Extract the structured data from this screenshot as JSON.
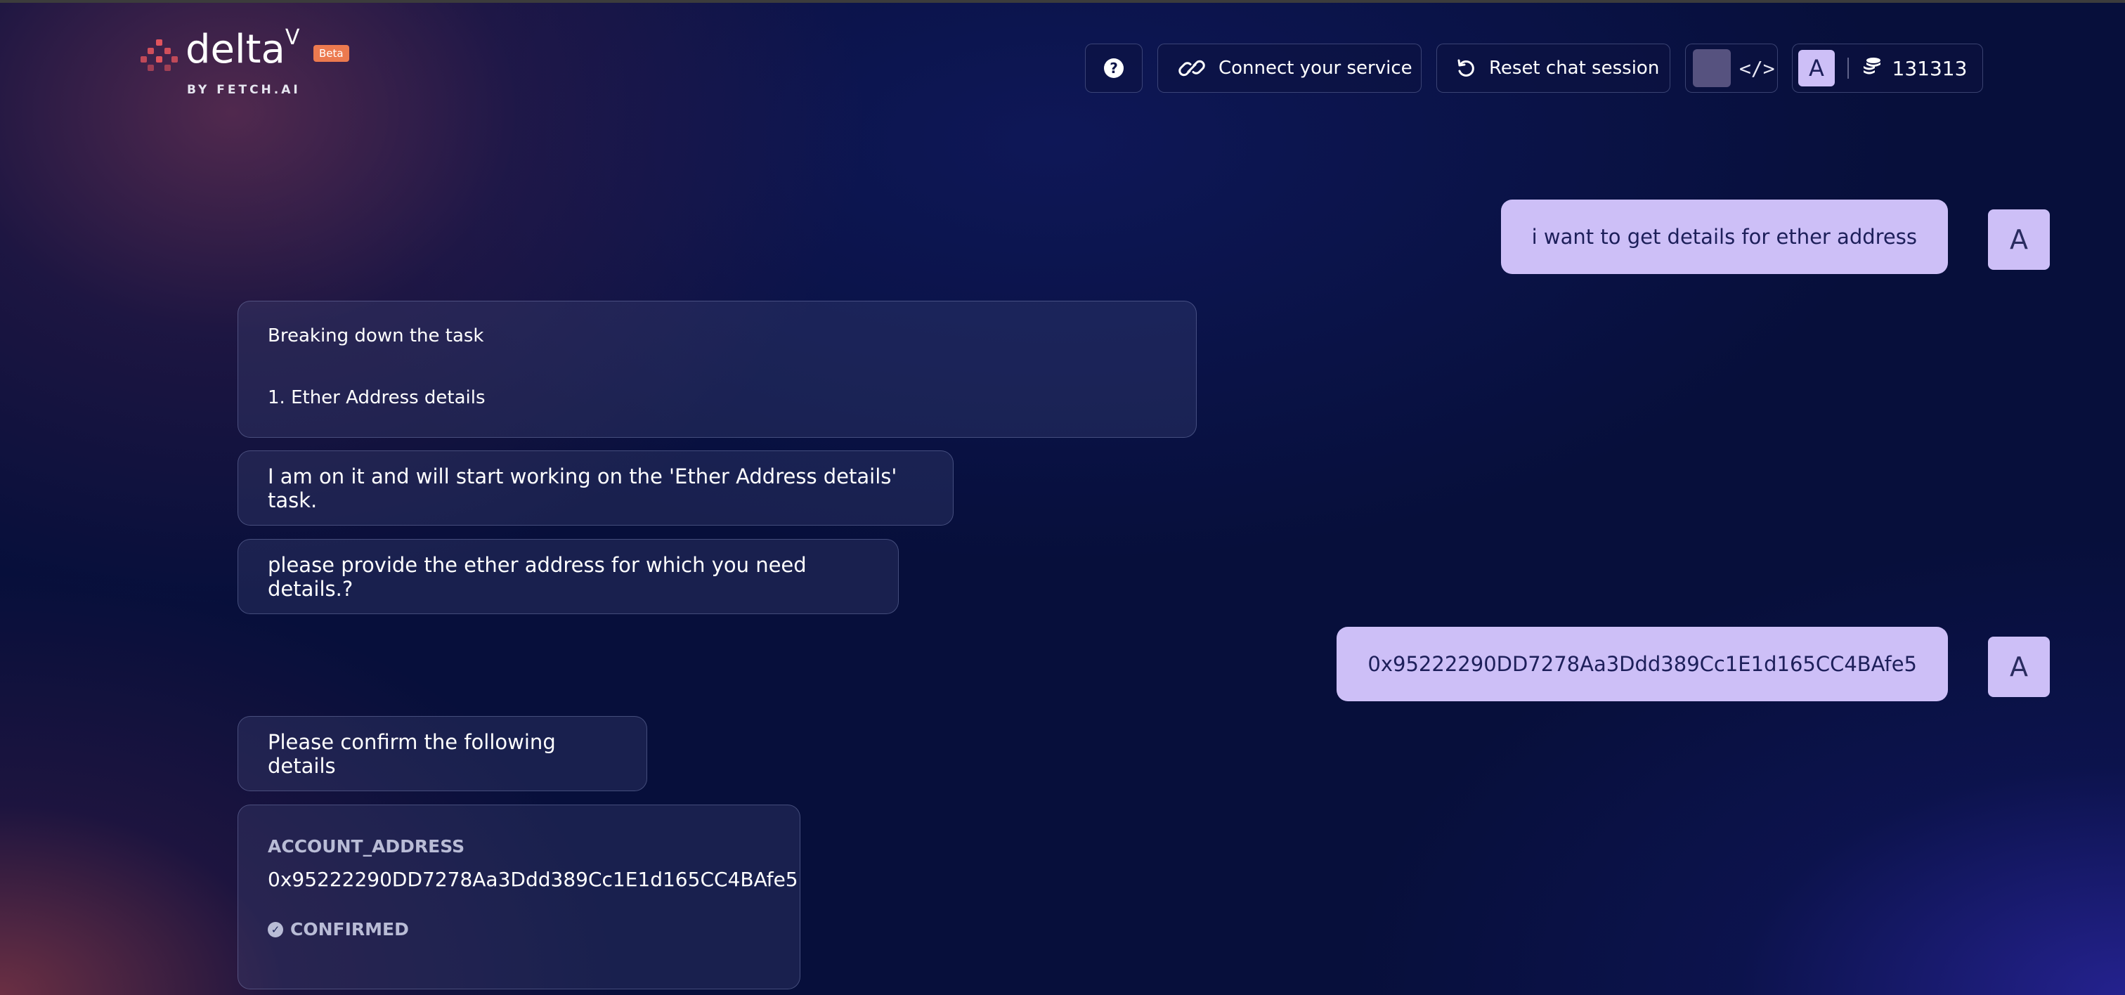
{
  "brand": {
    "name": "delta",
    "superscript": "V",
    "badge": "Beta",
    "byline": "BY FETCH.AI"
  },
  "header": {
    "help_icon_glyph": "?",
    "connect_label": "Connect your service",
    "reset_label": "Reset chat session",
    "code_icon_glyph": "</>",
    "account_initial": "A",
    "credits": "131313"
  },
  "chat": {
    "messages": [
      {
        "role": "user",
        "text": "i want to get details for ether address",
        "avatar": "A"
      },
      {
        "role": "agent",
        "title": "Breaking down the task",
        "item": "1. Ether Address details"
      },
      {
        "role": "agent",
        "text": "I am on it and will start working on the 'Ether Address details' task."
      },
      {
        "role": "agent",
        "text": "please provide the ether address for which you need details.?"
      },
      {
        "role": "user",
        "text": "0x95222290DD7278Aa3Ddd389Cc1E1d165CC4BAfe5",
        "avatar": "A"
      },
      {
        "role": "agent",
        "text": "Please confirm the following details"
      },
      {
        "role": "agent",
        "field_label": "ACCOUNT_ADDRESS",
        "field_value": "0x95222290DD7278Aa3Ddd389Cc1E1d165CC4BAfe5",
        "status": "CONFIRMED"
      }
    ]
  },
  "colors": {
    "background": "#070f3b",
    "user_bubble": "#cdbff7",
    "brand_accent": "#e0545d",
    "beta_badge": "#ec7a4f"
  },
  "icons": [
    "fetch-logo-icon",
    "help-icon",
    "link-icon",
    "refresh-icon",
    "code-icon",
    "coins-icon",
    "check-circle-icon"
  ]
}
